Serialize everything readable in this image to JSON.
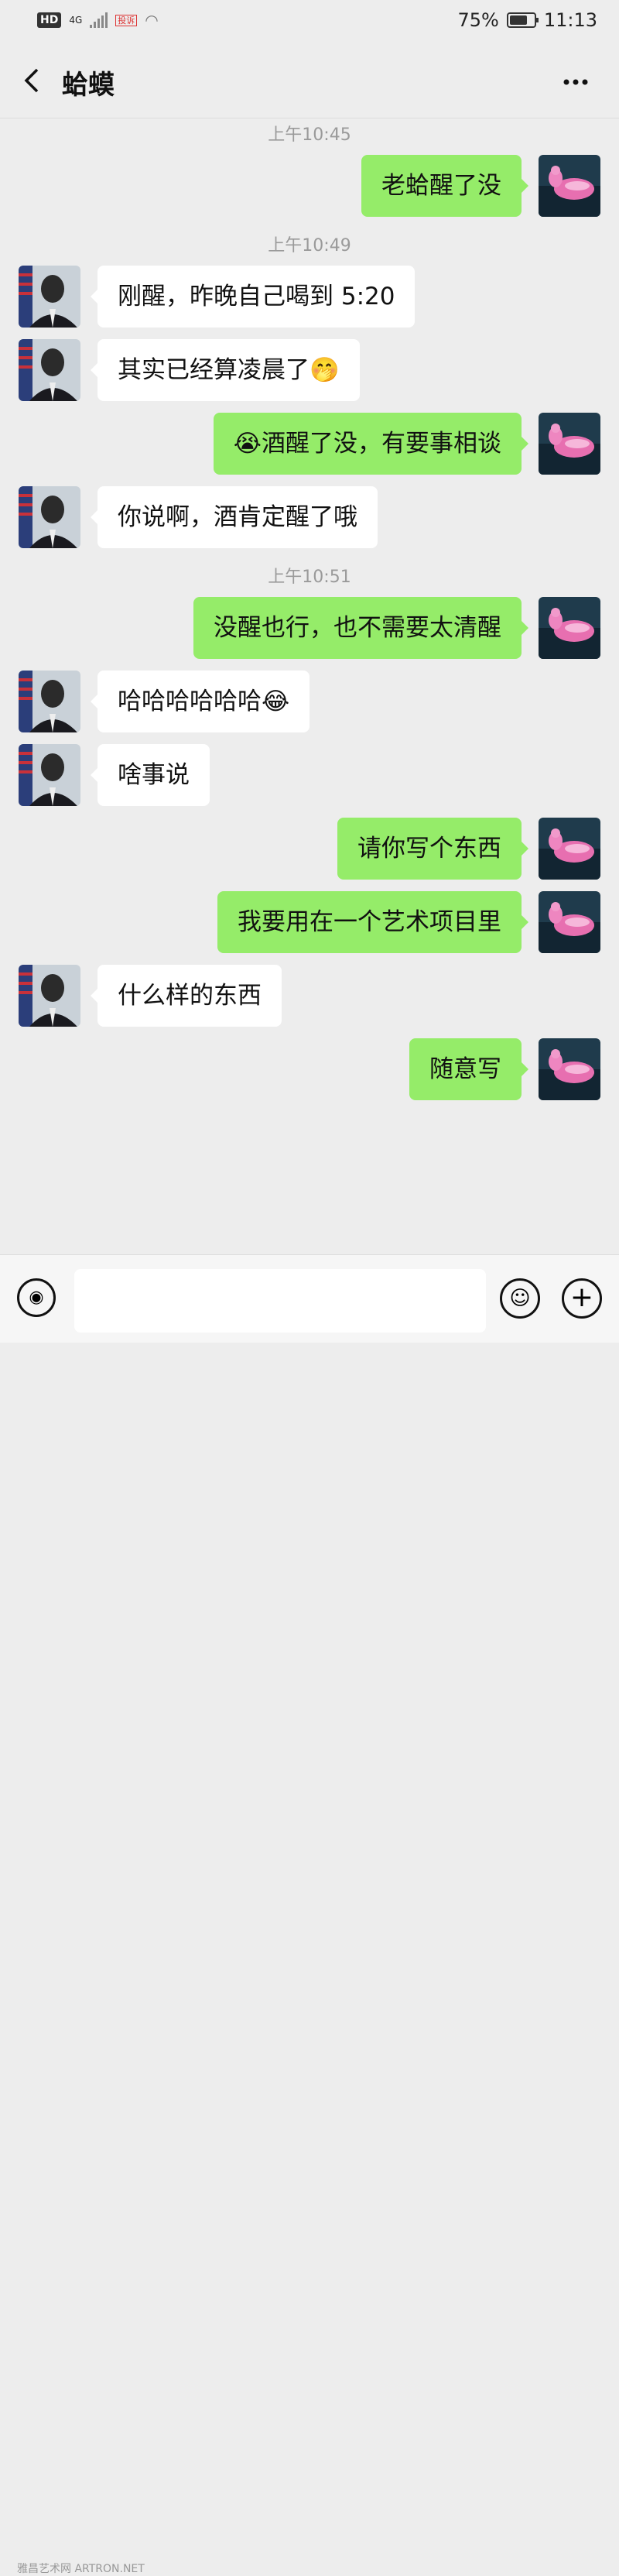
{
  "status_bar": {
    "hd": "HD",
    "network": "4G",
    "carrier_badge": "投诉\n处理",
    "battery": "75%",
    "battery_level": 0.75,
    "time": "11:13"
  },
  "header": {
    "title": "蛤蟆",
    "back_icon": "chevron-left-icon",
    "more_icon": "more-dots-icon"
  },
  "messages": [
    {
      "type": "time",
      "text": "上午10:45"
    },
    {
      "type": "msg",
      "side": "out",
      "text": "老蛤醒了没"
    },
    {
      "type": "time",
      "text": "上午10:49"
    },
    {
      "type": "msg",
      "side": "in",
      "text": "刚醒，昨晚自己喝到 5:20"
    },
    {
      "type": "msg",
      "side": "in",
      "text": "其实已经算凌晨了🤭"
    },
    {
      "type": "msg",
      "side": "out",
      "text": "😭酒醒了没，有要事相谈"
    },
    {
      "type": "msg",
      "side": "in",
      "text": "你说啊，酒肯定醒了哦"
    },
    {
      "type": "time",
      "text": "上午10:51"
    },
    {
      "type": "msg",
      "side": "out",
      "text": "没醒也行，也不需要太清醒"
    },
    {
      "type": "msg",
      "side": "in",
      "text": "哈哈哈哈哈哈😂"
    },
    {
      "type": "msg",
      "side": "in",
      "text": "啥事说"
    },
    {
      "type": "msg",
      "side": "out",
      "text": "请你写个东西"
    },
    {
      "type": "msg",
      "side": "out",
      "text": "我要用在一个艺术项目里"
    },
    {
      "type": "msg",
      "side": "in",
      "text": "什么样的东西"
    },
    {
      "type": "msg",
      "side": "out",
      "text": "随意写"
    }
  ],
  "input_bar": {
    "voice_icon": "voice-icon",
    "emoji_icon": "emoji-icon",
    "plus_icon": "plus-icon",
    "placeholder": ""
  },
  "watermark": "雅昌艺术网 ARTRON.NET",
  "colors": {
    "background": "#ededed",
    "outgoing_bubble": "#95ec69",
    "incoming_bubble": "#ffffff",
    "timestamp": "#9a9a9a"
  }
}
